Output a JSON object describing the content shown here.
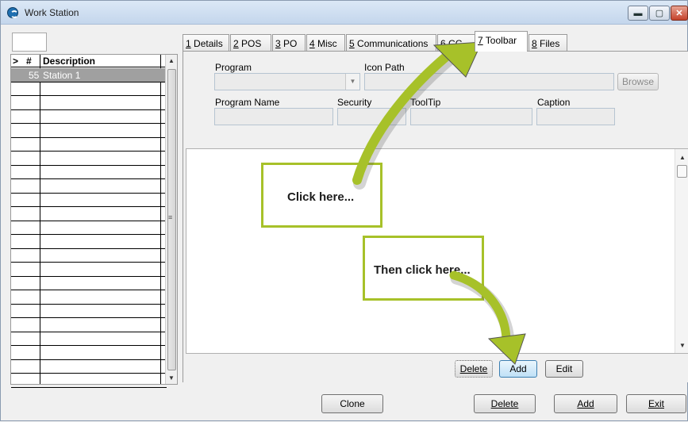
{
  "window": {
    "title": "Work Station"
  },
  "grid": {
    "headers": {
      "marker": ">",
      "num": "#",
      "description": "Description"
    },
    "selected_row": {
      "num": "55",
      "description": "Station 1"
    }
  },
  "tabs": [
    {
      "key": "1",
      "rest": " Details"
    },
    {
      "key": "2",
      "rest": " POS"
    },
    {
      "key": "3",
      "rest": " PO"
    },
    {
      "key": "4",
      "rest": " Misc"
    },
    {
      "key": "5",
      "rest": " Communications"
    },
    {
      "key": "6",
      "rest": " CC"
    },
    {
      "key": "7",
      "rest": " Toolbar"
    },
    {
      "key": "8",
      "rest": " Files"
    }
  ],
  "toolbar_tab": {
    "program_label": "Program",
    "icon_path_label": "Icon Path",
    "browse_label": "Browse",
    "program_name_label": "Program Name",
    "security_label": "Security",
    "tooltip_label": "ToolTip",
    "caption_label": "Caption",
    "delete_label": "Delete",
    "add_label": "Add",
    "edit_label": "Edit"
  },
  "callouts": {
    "first": "Click here...",
    "second": "Then click here..."
  },
  "footer": {
    "clone_label": "Clone",
    "delete_label": "Delete",
    "add_label": "Add",
    "exit_label": "Exit"
  },
  "colors": {
    "accent": "#a7c129",
    "selected_row": "#a0a0a0"
  }
}
